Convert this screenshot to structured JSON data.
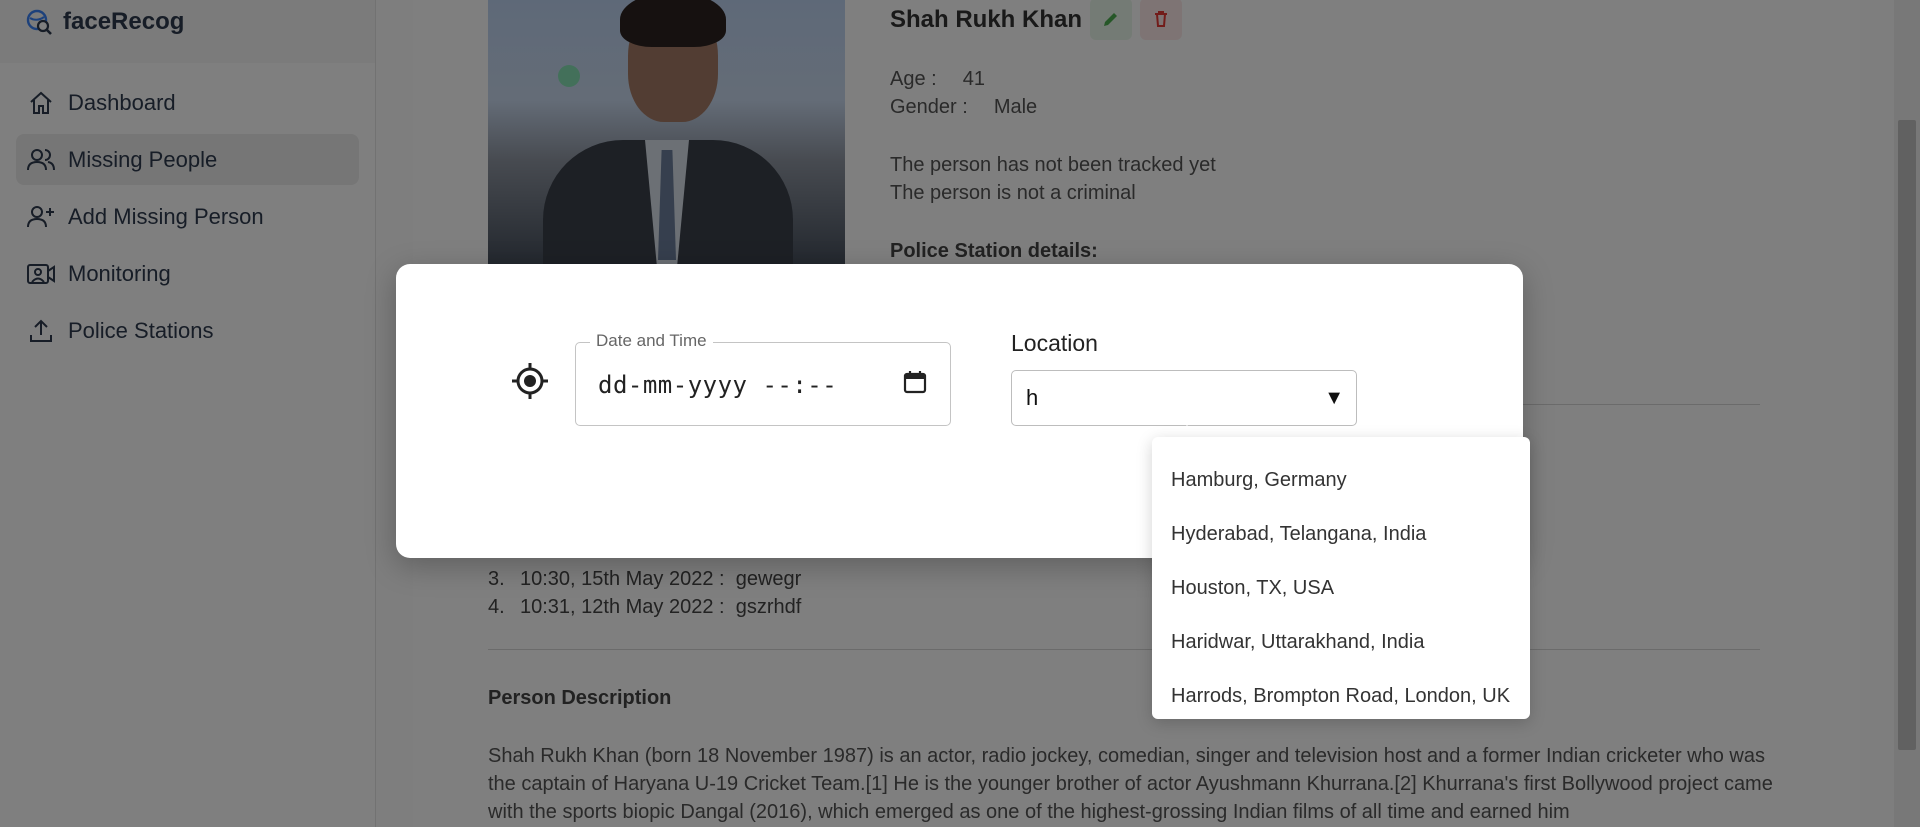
{
  "app": {
    "name": "faceRecog"
  },
  "sidebar": {
    "items": [
      {
        "label": "Dashboard",
        "icon": "home-icon"
      },
      {
        "label": "Missing People",
        "icon": "users-icon",
        "active": true
      },
      {
        "label": "Add Missing Person",
        "icon": "user-plus-icon"
      },
      {
        "label": "Monitoring",
        "icon": "camera-icon"
      },
      {
        "label": "Police Stations",
        "icon": "upload-icon"
      }
    ]
  },
  "person": {
    "name": "Shah Rukh Khan",
    "age_label": "Age :",
    "age": "41",
    "gender_label": "Gender :",
    "gender": "Male",
    "tracked_status": "The person has not been tracked yet",
    "criminal_status": "The person is not a criminal",
    "police_heading": "Police Station details:"
  },
  "sightings": [
    {
      "num": "3.",
      "time": "10:30, 15th May 2022 :",
      "loc": "gewegr"
    },
    {
      "num": "4.",
      "time": "10:31, 12th May 2022 :",
      "loc": "gszrhdf"
    }
  ],
  "description": {
    "heading": "Person Description",
    "text": "Shah Rukh Khan (born 18 November 1987) is an actor, radio jockey, comedian, singer and television host and a former Indian cricketer who was the captain of Haryana U-19 Cricket Team.[1] He is the younger brother of actor Ayushmann Khurrana.[2] Khurrana's first Bollywood project came with the sports biopic Dangal (2016), which emerged as one of the highest-grossing Indian films of all time and earned him"
  },
  "modal": {
    "datetime_label": "Date and Time",
    "datetime_placeholder": "dd-mm-yyyy --:--",
    "location_label": "Location",
    "location_value": "h"
  },
  "dropdown": {
    "options": [
      "Hamburg, Germany",
      "Hyderabad, Telangana, India",
      "Houston, TX, USA",
      "Haridwar, Uttarakhand, India",
      "Harrods, Brompton Road, London, UK"
    ]
  },
  "colors": {
    "edit": "#4caf50",
    "delete": "#e53935",
    "brand": "#2e3b4e"
  }
}
